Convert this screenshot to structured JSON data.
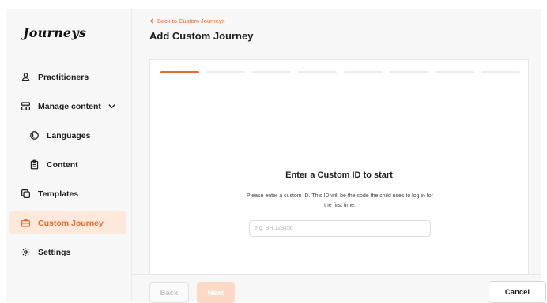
{
  "brand": {
    "logo": "Journeys",
    "accent": "#e86a2e",
    "active_bg": "#fde9dc"
  },
  "sidebar": {
    "items": [
      {
        "label": "Practitioners",
        "icon": "users-icon"
      },
      {
        "label": "Manage content",
        "icon": "layout-icon",
        "expanded": true
      },
      {
        "label": "Languages",
        "icon": "globe-icon"
      },
      {
        "label": "Content",
        "icon": "clipboard-icon"
      },
      {
        "label": "Templates",
        "icon": "copy-icon"
      },
      {
        "label": "Custom Journey",
        "icon": "briefcase-icon",
        "active": true
      },
      {
        "label": "Settings",
        "icon": "gear-icon"
      }
    ]
  },
  "header": {
    "back_label": "Back to Custom Journeys",
    "title": "Add Custom Journey"
  },
  "stepper": {
    "total_steps": 8,
    "current_step": 1
  },
  "form": {
    "heading": "Enter a Custom ID to start",
    "description": "Please enter a custom ID. This ID will be the code the child uses to log in for the first time.",
    "input_value": "",
    "input_placeholder": "e.g. BH 123456"
  },
  "footer": {
    "back_label": "Back",
    "next_label": "Next",
    "cancel_label": "Cancel"
  }
}
